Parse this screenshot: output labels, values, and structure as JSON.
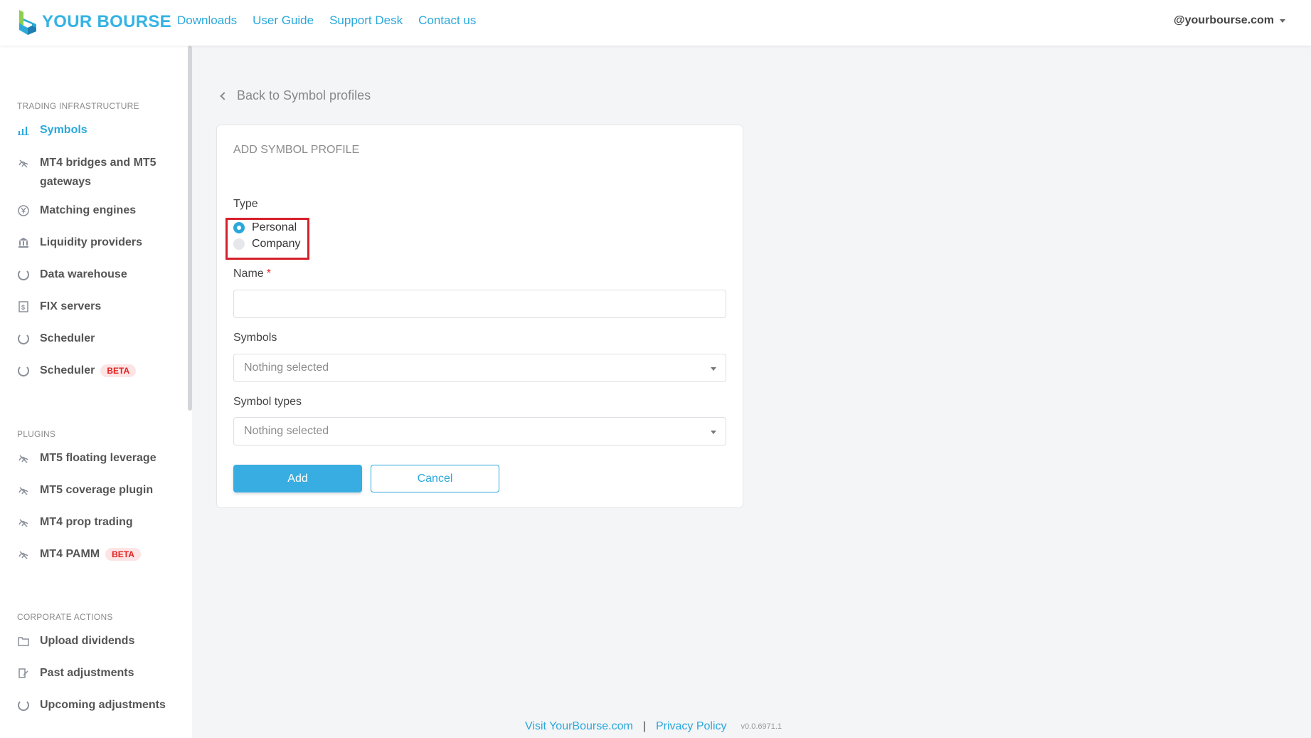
{
  "header": {
    "logo_text": "YOUR BOURSE",
    "nav": [
      "Downloads",
      "User Guide",
      "Support Desk",
      "Contact us"
    ],
    "user": "@yourbourse.com"
  },
  "sidebar": {
    "sections": [
      {
        "title": "TRADING INFRASTRUCTURE",
        "items": [
          {
            "label": "Symbols",
            "icon": "bar-chart-icon",
            "active": true
          },
          {
            "label": "MT4 bridges and MT5 gateways",
            "icon": "bridge-icon"
          },
          {
            "label": "Matching engines",
            "icon": "currency-icon"
          },
          {
            "label": "Liquidity providers",
            "icon": "bank-icon"
          },
          {
            "label": "Data warehouse",
            "icon": "circle-icon"
          },
          {
            "label": "FIX servers",
            "icon": "document-icon"
          },
          {
            "label": "Scheduler",
            "icon": "circle-icon"
          },
          {
            "label": "Scheduler",
            "icon": "circle-icon",
            "badge": "BETA"
          }
        ]
      },
      {
        "title": "PLUGINS",
        "items": [
          {
            "label": "MT5 floating leverage",
            "icon": "bridge-icon"
          },
          {
            "label": "MT5 coverage plugin",
            "icon": "bridge-icon"
          },
          {
            "label": "MT4 prop trading",
            "icon": "bridge-icon"
          },
          {
            "label": "MT4 PAMM",
            "icon": "bridge-icon",
            "badge": "BETA"
          }
        ]
      },
      {
        "title": "CORPORATE ACTIONS",
        "items": [
          {
            "label": "Upload dividends",
            "icon": "folder-icon"
          },
          {
            "label": "Past adjustments",
            "icon": "edit-icon"
          },
          {
            "label": "Upcoming adjustments",
            "icon": "circle-icon"
          }
        ]
      }
    ]
  },
  "main": {
    "back_link": "Back to Symbol profiles",
    "card_title": "ADD SYMBOL PROFILE",
    "type_label": "Type",
    "type_options": [
      {
        "label": "Personal",
        "checked": true
      },
      {
        "label": "Company",
        "checked": false
      }
    ],
    "name_label": "Name",
    "name_required": "*",
    "name_value": "",
    "symbols_label": "Symbols",
    "symbols_value": "Nothing selected",
    "symbol_types_label": "Symbol types",
    "symbol_types_value": "Nothing selected",
    "add_label": "Add",
    "cancel_label": "Cancel"
  },
  "footer": {
    "visit": "Visit YourBourse.com",
    "separator": "|",
    "privacy": "Privacy Policy",
    "version": "v0.0.6971.1"
  },
  "colors": {
    "accent": "#2aa8dc",
    "button": "#38ade1",
    "highlight_box": "#d6202b",
    "beta_text": "#e52121",
    "beta_bg": "#fde5e5"
  }
}
